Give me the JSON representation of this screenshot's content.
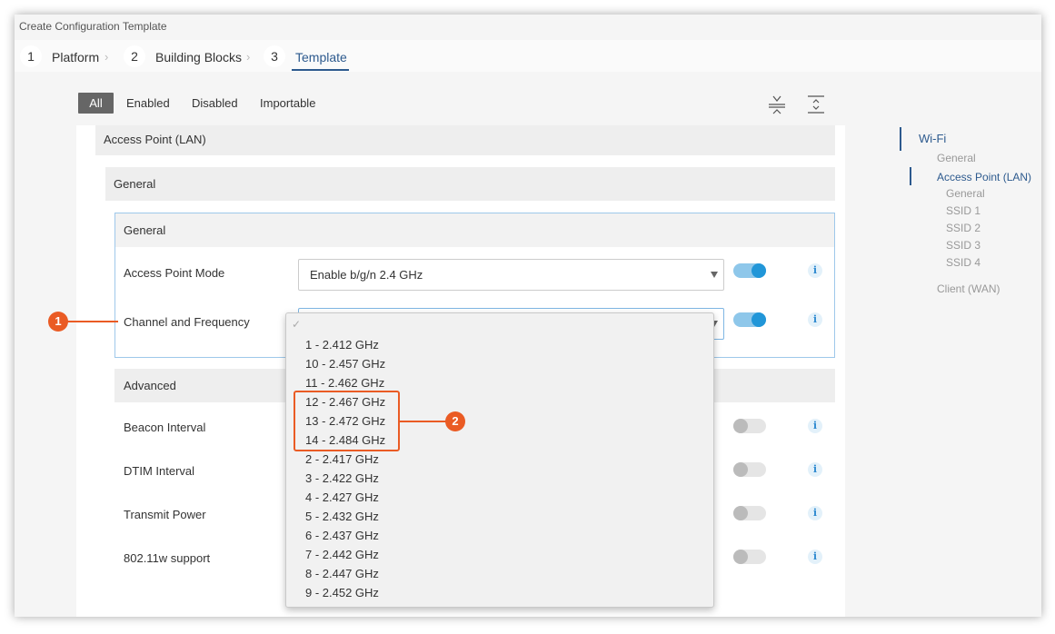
{
  "window": {
    "title": "Create Configuration Template"
  },
  "steps": [
    {
      "num": "1",
      "label": "Platform"
    },
    {
      "num": "2",
      "label": "Building Blocks"
    },
    {
      "num": "3",
      "label": "Template"
    }
  ],
  "filters": {
    "all": "All",
    "enabled": "Enabled",
    "disabled": "Disabled",
    "importable": "Importable"
  },
  "sections": {
    "access_point": "Access Point (LAN)",
    "general_outer": "General",
    "general_inner": "General",
    "advanced": "Advanced"
  },
  "fields": {
    "ap_mode": {
      "label": "Access Point Mode",
      "value": "Enable b/g/n 2.4 GHz"
    },
    "channel": {
      "label": "Channel and Frequency"
    },
    "beacon": {
      "label": "Beacon Interval"
    },
    "dtim": {
      "label": "DTIM Interval"
    },
    "tx_power": {
      "label": "Transmit Power"
    },
    "w_support": {
      "label": "802.11w support"
    }
  },
  "dropdown": {
    "check_mark": "✓",
    "options": [
      "1 - 2.412 GHz",
      "10 - 2.457 GHz",
      "11 - 2.462 GHz",
      "12 - 2.467 GHz",
      "13 - 2.472 GHz",
      "14 - 2.484 GHz",
      "2 - 2.417 GHz",
      "3 - 2.422 GHz",
      "4 - 2.427 GHz",
      "5 - 2.432 GHz",
      "6 - 2.437 GHz",
      "7 - 2.442 GHz",
      "8 - 2.447 GHz",
      "9 - 2.452 GHz"
    ]
  },
  "callouts": {
    "one": "1",
    "two": "2"
  },
  "info_glyph": "i",
  "nav": {
    "wifi": "Wi-Fi",
    "general": "General",
    "access_point": "Access Point (LAN)",
    "ap_general": "General",
    "ssid1": "SSID 1",
    "ssid2": "SSID 2",
    "ssid3": "SSID 3",
    "ssid4": "SSID 4",
    "client": "Client (WAN)"
  },
  "colors": {
    "accent": "#2d5a8e",
    "callout": "#ea5b24",
    "toggle_on": "#2196d8"
  }
}
